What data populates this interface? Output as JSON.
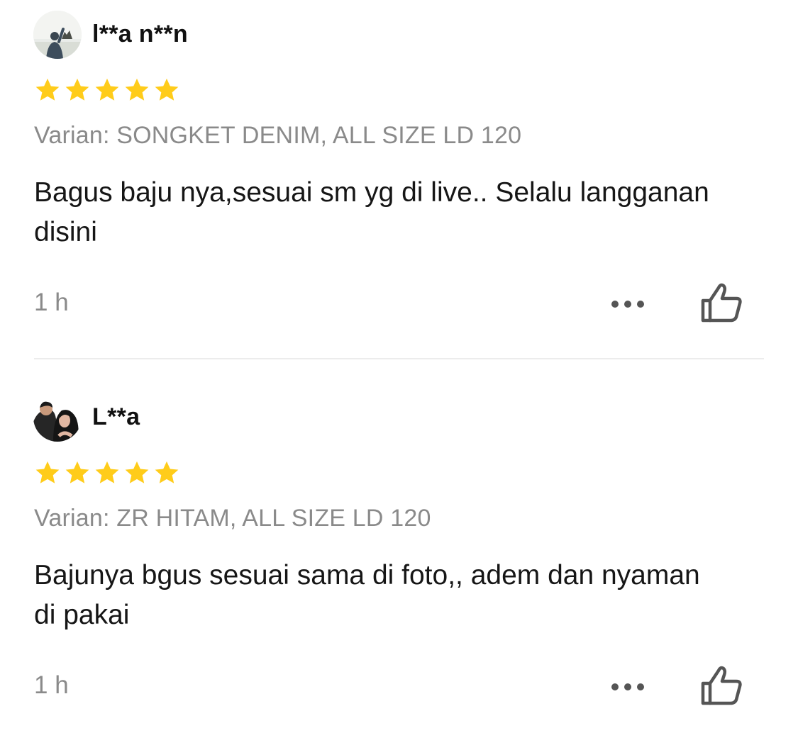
{
  "colors": {
    "star": "#FFCC1A",
    "variant_text": "#8A8A8A",
    "icon_stroke": "#555555",
    "divider": "#ECECEC"
  },
  "reviews": [
    {
      "avatar_icon": "user-avatar-photo",
      "username": "l**a n**n",
      "rating": 5,
      "variant": "Varian: SONGKET DENIM, ALL SIZE LD 120",
      "comment": "Bagus baju nya,sesuai sm yg di live.. Selalu langganan disini",
      "time": "1 h",
      "more_icon": "more-options-icon",
      "like_icon": "thumbs-up-icon"
    },
    {
      "avatar_icon": "user-avatar-photo",
      "username": "L**a",
      "rating": 5,
      "variant": "Varian: ZR HITAM, ALL SIZE LD 120",
      "comment": "Bajunya bgus sesuai sama di foto,, adem dan nyaman di pakai",
      "time": "1 h",
      "more_icon": "more-options-icon",
      "like_icon": "thumbs-up-icon"
    }
  ]
}
